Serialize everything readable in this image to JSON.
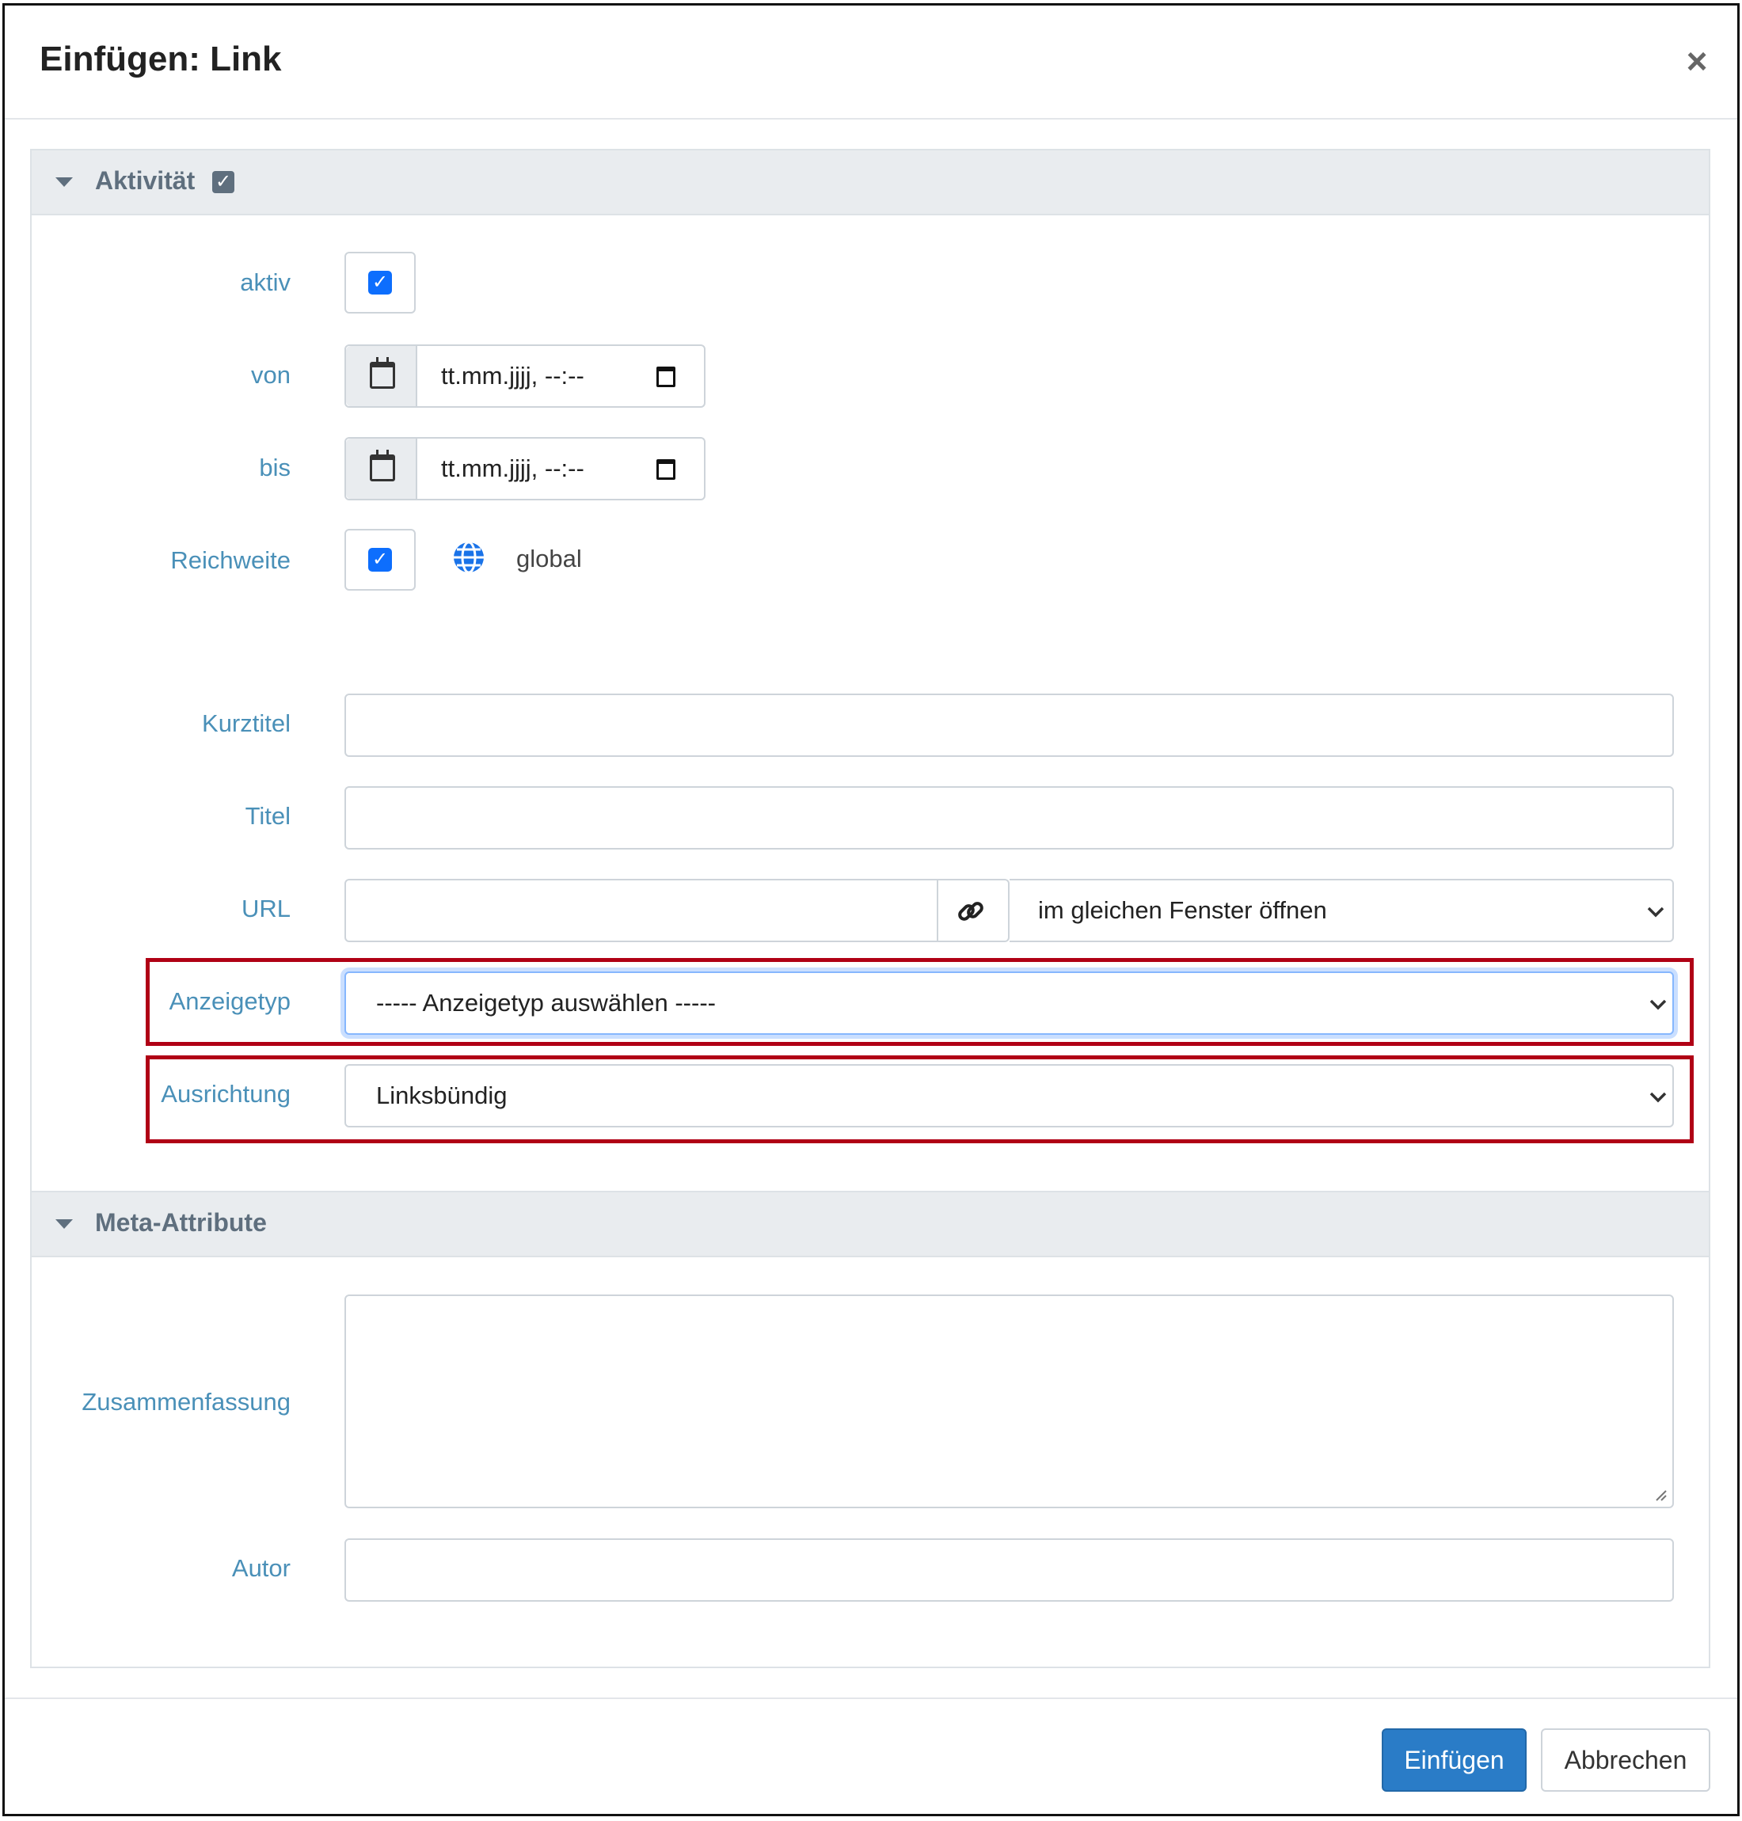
{
  "dialog": {
    "title": "Einfügen: Link",
    "close_symbol": "×"
  },
  "sections": {
    "activity": {
      "title": "Aktivität",
      "header_checkbox": true,
      "fields": {
        "active": {
          "label": "aktiv",
          "checked": true
        },
        "from": {
          "label": "von",
          "placeholder": "tt.mm.jjjj, --:--"
        },
        "to": {
          "label": "bis",
          "placeholder": "tt.mm.jjjj, --:--"
        },
        "scope": {
          "label": "Reichweite",
          "checked": true,
          "value": "global",
          "icon": "globe-icon"
        }
      }
    },
    "link": {
      "short_title": {
        "label": "Kurztitel",
        "value": ""
      },
      "title": {
        "label": "Titel",
        "value": ""
      },
      "url": {
        "label": "URL",
        "value": "",
        "link_icon": "link-icon",
        "target": "im gleichen Fenster öffnen"
      },
      "display_type": {
        "label": "Anzeigetyp",
        "selected": "----- Anzeigetyp auswählen -----"
      },
      "alignment": {
        "label": "Ausrichtung",
        "selected": "Linksbündig"
      }
    },
    "meta": {
      "title": "Meta-Attribute",
      "fields": {
        "summary": {
          "label": "Zusammenfassung",
          "value": ""
        },
        "author": {
          "label": "Autor",
          "value": ""
        }
      }
    }
  },
  "footer": {
    "insert_label": "Einfügen",
    "cancel_label": "Abbrechen"
  },
  "colors": {
    "label": "#4a90b8",
    "primary": "#2a7cc7",
    "highlight": "#b00015",
    "checkbox": "#0d6efd"
  }
}
